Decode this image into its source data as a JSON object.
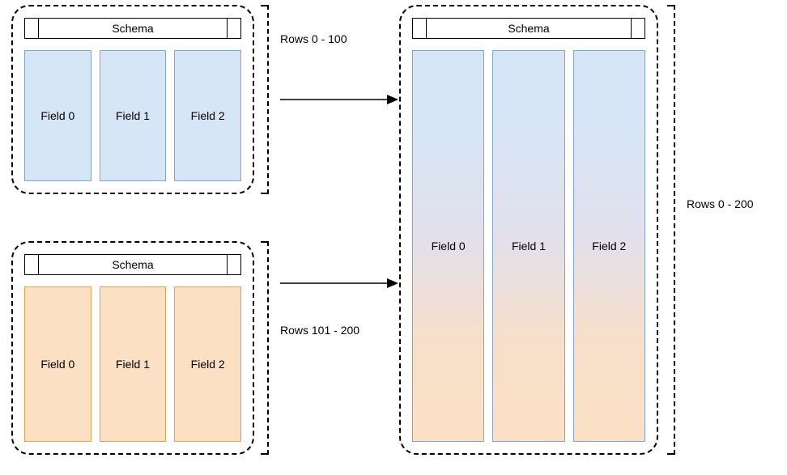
{
  "batch_a": {
    "schema": "Schema",
    "fields": [
      "Field 0",
      "Field 1",
      "Field 2"
    ],
    "rows_label": "Rows 0 - 100"
  },
  "batch_b": {
    "schema": "Schema",
    "fields": [
      "Field 0",
      "Field 1",
      "Field 2"
    ],
    "rows_label": "Rows 101 - 200"
  },
  "merged": {
    "schema": "Schema",
    "fields": [
      "Field 0",
      "Field 1",
      "Field 2"
    ],
    "rows_label": "Rows 0 - 200"
  }
}
